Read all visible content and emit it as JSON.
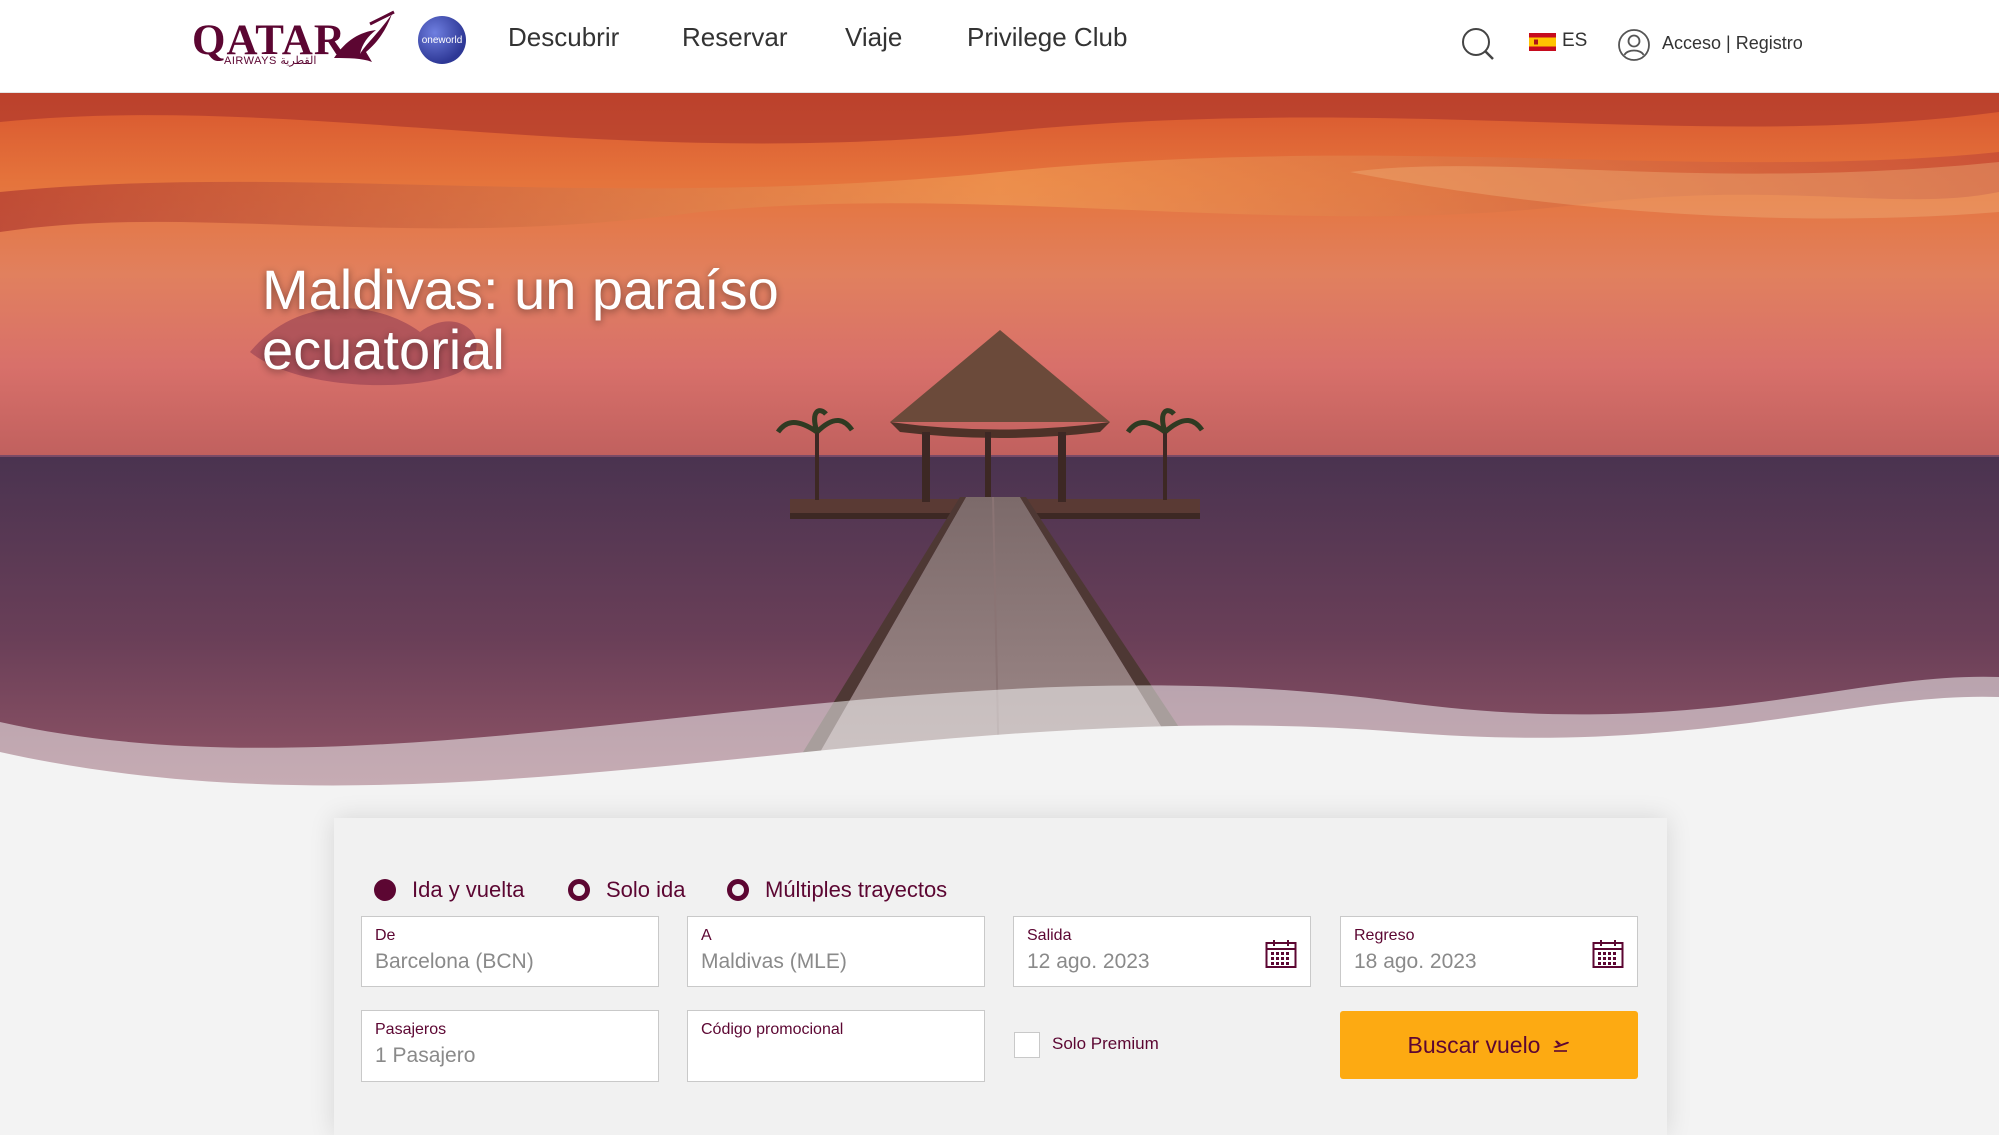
{
  "brand": {
    "logo_text": "QATAR",
    "logo_sub": "AIRWAYS",
    "logo_arabic": "القطرية",
    "alliance": "oneworld"
  },
  "nav": {
    "items": [
      "Descubrir",
      "Reservar",
      "Viaje",
      "Privilege Club"
    ]
  },
  "header": {
    "language": "ES",
    "login": "Acceso | Registro"
  },
  "hero": {
    "title": "Maldivas: un paraíso ecuatorial"
  },
  "booking": {
    "trip_types": [
      {
        "label": "Ida y vuelta",
        "selected": true
      },
      {
        "label": "Solo ida",
        "selected": false
      },
      {
        "label": "Múltiples trayectos",
        "selected": false
      }
    ],
    "from": {
      "label": "De",
      "value": "Barcelona (BCN)"
    },
    "to": {
      "label": "A",
      "value": "Maldivas (MLE)"
    },
    "departure": {
      "label": "Salida",
      "value": "12 ago. 2023"
    },
    "return": {
      "label": "Regreso",
      "value": "18 ago. 2023"
    },
    "passengers": {
      "label": "Pasajeros",
      "value": "1 Pasajero"
    },
    "promo": {
      "label": "Código promocional",
      "value": ""
    },
    "premium_only": {
      "label": "Solo Premium",
      "checked": false
    },
    "search_button": "Buscar vuelo"
  },
  "colors": {
    "brand": "#5c0632",
    "button": "#fdaa12",
    "oneworld": "#2e3896"
  }
}
